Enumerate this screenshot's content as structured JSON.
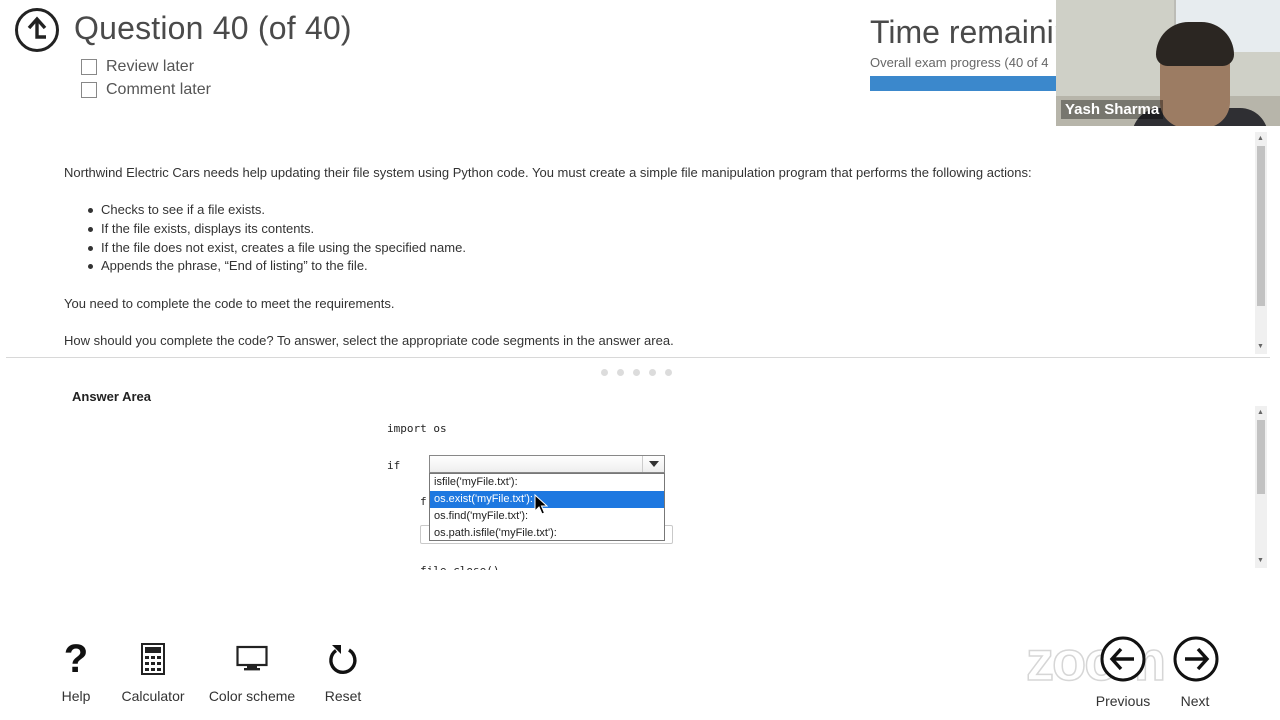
{
  "header": {
    "title": "Question 40 (of 40)",
    "review_later": "Review later",
    "comment_later": "Comment later",
    "time_title": "Time remainin",
    "progress_label": "Overall exam progress (40 of 4",
    "progress_fraction": 1.0
  },
  "webcam": {
    "name": "Yash Sharma"
  },
  "question": {
    "intro": "Northwind Electric Cars needs help updating their file system using Python code. You must create a simple file manipulation program that performs the following actions:",
    "bullets": [
      "Checks to see if a file exists.",
      "If the file exists, displays its contents.",
      "If the file does not exist, creates a file using the specified name.",
      "Appends the phrase, “End of listing” to the file."
    ],
    "requirement": "You need to complete the code to meet the requirements.",
    "prompt": "How should you complete the code? To answer, select the appropriate code segments in the answer area."
  },
  "answer": {
    "title": "Answer Area",
    "code_import": "import os",
    "code_if": "if",
    "code_f": "f",
    "code_partial": "file.close()",
    "dropdown_value": "",
    "options": [
      "isfile('myFile.txt'):",
      "os.exist('myFile.txt'):",
      "os.find('myFile.txt'):",
      "os.path.isfile('myFile.txt'):"
    ],
    "selected_index": 1
  },
  "toolbar": {
    "help": "Help",
    "calculator": "Calculator",
    "color_scheme": "Color scheme",
    "reset": "Reset",
    "previous": "Previous",
    "next": "Next",
    "watermark": "zoom"
  },
  "colors": {
    "accent": "#3b88cc",
    "selection": "#1e78e0"
  },
  "icons": {
    "back": "back-arrow-circle-icon",
    "help": "question-mark-icon",
    "calculator": "calculator-icon",
    "color_scheme": "monitor-icon",
    "reset": "reset-icon",
    "previous": "left-arrow-circle-icon",
    "next": "right-arrow-circle-icon"
  }
}
